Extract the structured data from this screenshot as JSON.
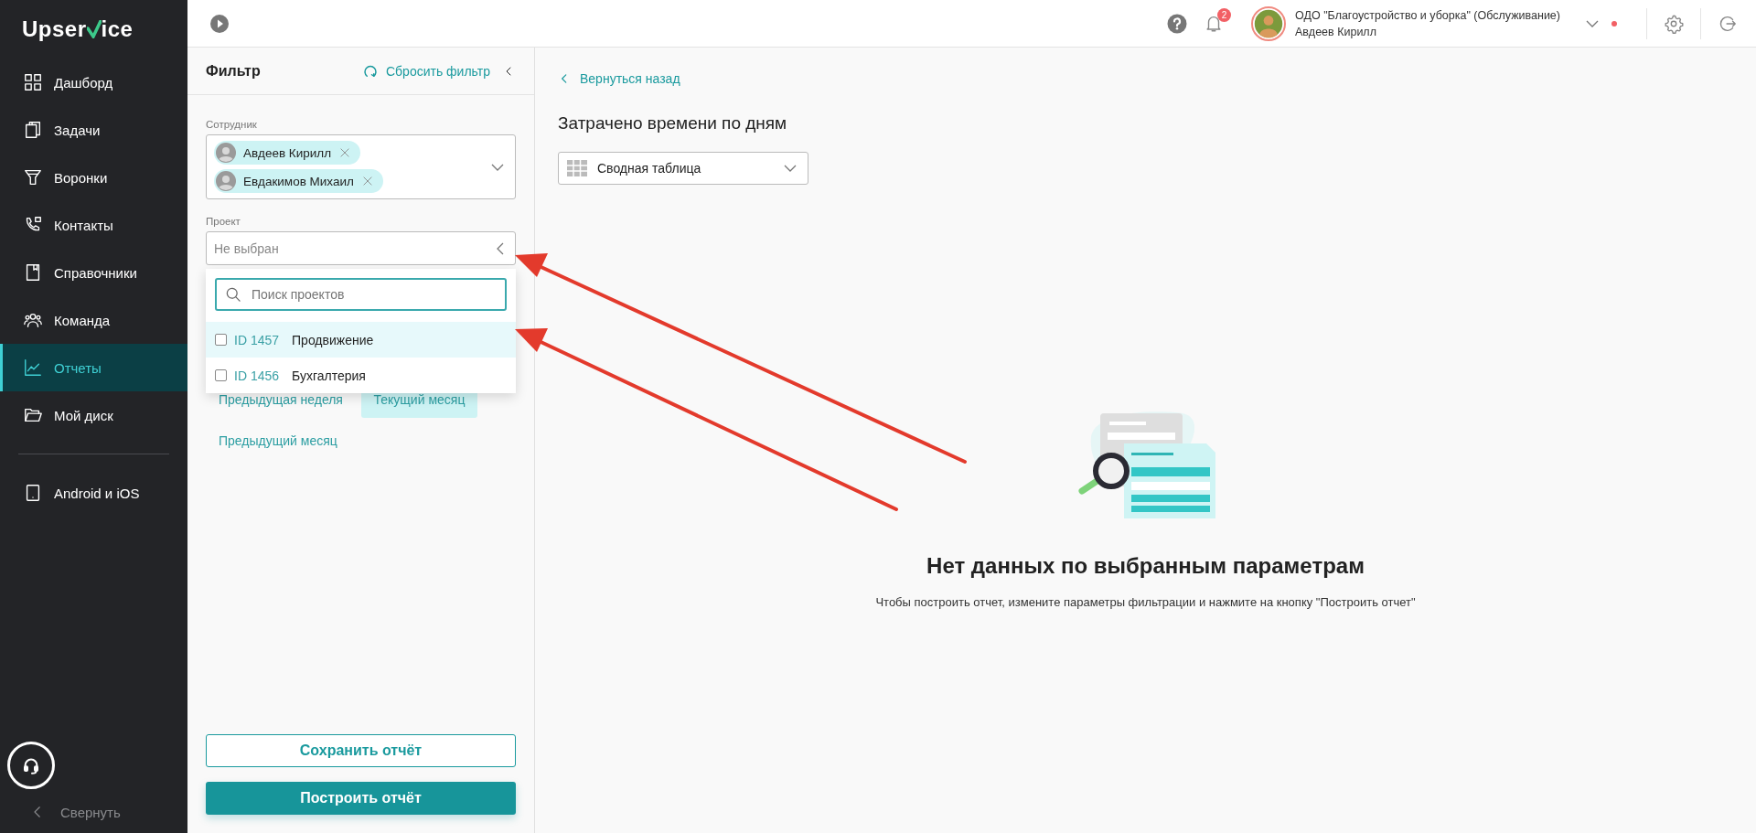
{
  "logo": {
    "before": "Upser",
    "after": "ice"
  },
  "sidebar": {
    "items": [
      {
        "label": "Дашборд",
        "selected": false
      },
      {
        "label": "Задачи",
        "selected": false
      },
      {
        "label": "Воронки",
        "selected": false
      },
      {
        "label": "Контакты",
        "selected": false
      },
      {
        "label": "Справочники",
        "selected": false
      },
      {
        "label": "Команда",
        "selected": false
      },
      {
        "label": "Отчеты",
        "selected": true
      },
      {
        "label": "Мой диск",
        "selected": false
      }
    ],
    "apps_item": {
      "label": "Android и iOS"
    },
    "collapse": "Свернуть"
  },
  "header": {
    "notifications": "2",
    "account": {
      "organization": "ОДО \"Благоустройство и уборка\" (Обслуживание)",
      "user": "Авдеев Кирилл"
    }
  },
  "filter": {
    "title": "Фильтр",
    "reset": "Сбросить фильтр",
    "employee": {
      "label": "Сотрудник",
      "chips": [
        {
          "name": "Авдеев Кирилл"
        },
        {
          "name": "Евдакимов Михаил"
        }
      ]
    },
    "project": {
      "label": "Проект",
      "placeholder": "Не выбран",
      "expanded": true,
      "search_placeholder": "Поиск проектов",
      "options": [
        {
          "id": "ID 1457",
          "name": "Продвижение",
          "checked": false,
          "highlighted": true
        },
        {
          "id": "ID 1456",
          "name": "Бухгалтерия",
          "checked": false,
          "highlighted": false
        }
      ]
    },
    "periods": [
      {
        "label": "Предыдущая неделя",
        "selected": false
      },
      {
        "label": "Текущий месяц",
        "selected": true
      },
      {
        "label": "Предыдущий месяц",
        "selected": false
      }
    ],
    "save": "Сохранить отчёт",
    "build": "Построить отчёт"
  },
  "report": {
    "back": "Вернуться назад",
    "title": "Затрачено времени по дням",
    "view": "Сводная таблица",
    "empty_title": "Нет данных по выбранным параметрам",
    "empty_text": "Чтобы построить отчет, измените параметры фильтрации и нажмите на кнопку \"Построить отчет\""
  }
}
